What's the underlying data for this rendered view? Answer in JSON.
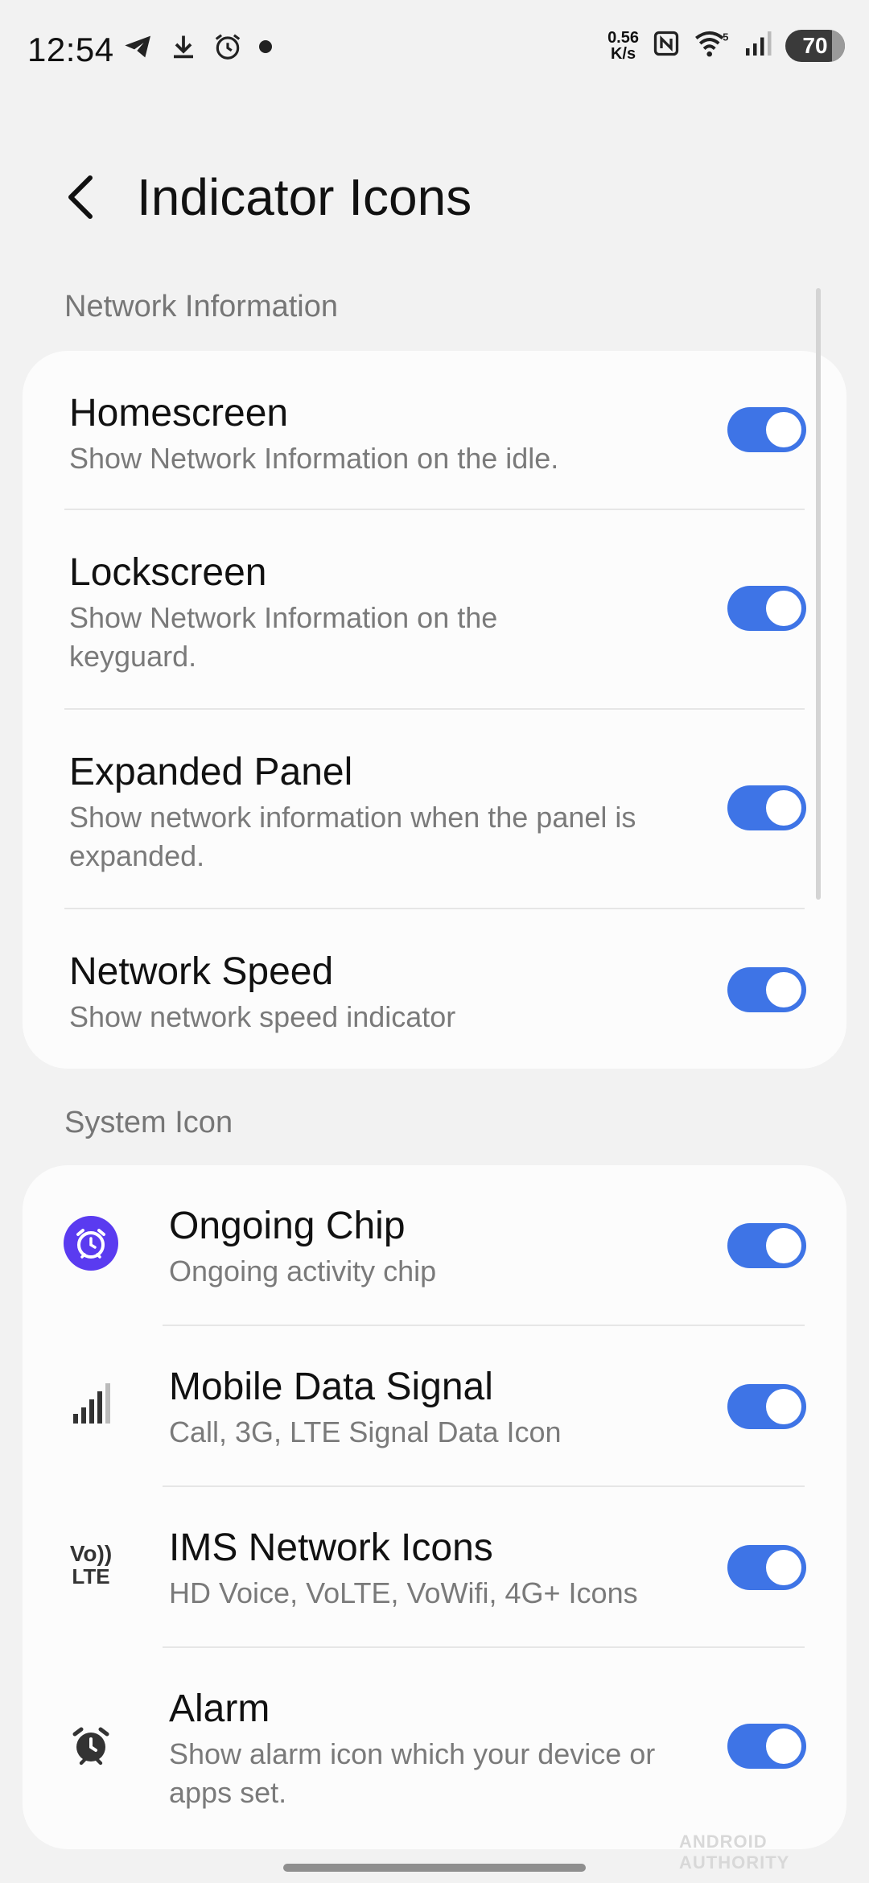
{
  "status_bar": {
    "time": "12:54",
    "net_speed_value": "0.56",
    "net_speed_unit": "K/s",
    "battery": "70",
    "icons": [
      "telegram-icon",
      "download-icon",
      "alarm-icon",
      "dot-icon",
      "nfc-icon",
      "wifi-icon",
      "signal-icon",
      "battery-icon"
    ]
  },
  "header": {
    "title": "Indicator Icons"
  },
  "sections": {
    "network": {
      "label": "Network Information",
      "items": [
        {
          "title": "Homescreen",
          "subtitle": "Show Network Information on the idle.",
          "enabled": true
        },
        {
          "title": "Lockscreen",
          "subtitle": "Show Network Information on the keyguard.",
          "enabled": true
        },
        {
          "title": "Expanded Panel",
          "subtitle": "Show network information when the panel is expanded.",
          "enabled": true
        },
        {
          "title": "Network Speed",
          "subtitle": "Show network speed indicator",
          "enabled": true
        }
      ]
    },
    "system": {
      "label": "System Icon",
      "items": [
        {
          "title": "Ongoing Chip",
          "subtitle": "Ongoing activity chip",
          "icon": "ongoing-chip-alarm-icon",
          "enabled": true
        },
        {
          "title": "Mobile Data Signal",
          "subtitle": "Call, 3G, LTE Signal Data Icon",
          "icon": "signal-bars-icon",
          "enabled": true
        },
        {
          "title": "IMS Network Icons",
          "subtitle": "HD Voice, VoLTE, VoWifi, 4G+ Icons",
          "icon": "volte-icon",
          "icon_text_top": "Vo",
          "icon_text_bottom": "LTE",
          "enabled": true
        },
        {
          "title": "Alarm",
          "subtitle": "Show alarm icon which your device or apps set.",
          "icon": "alarm-clock-icon",
          "enabled": true
        }
      ]
    }
  },
  "colors": {
    "background": "#f2f2f2",
    "card": "#fcfcfc",
    "toggle_on": "#3e74e6",
    "chip_icon": "#5a3bf0",
    "secondary_text": "#7a7a7a"
  },
  "watermark": "ANDROID AUTHORITY"
}
